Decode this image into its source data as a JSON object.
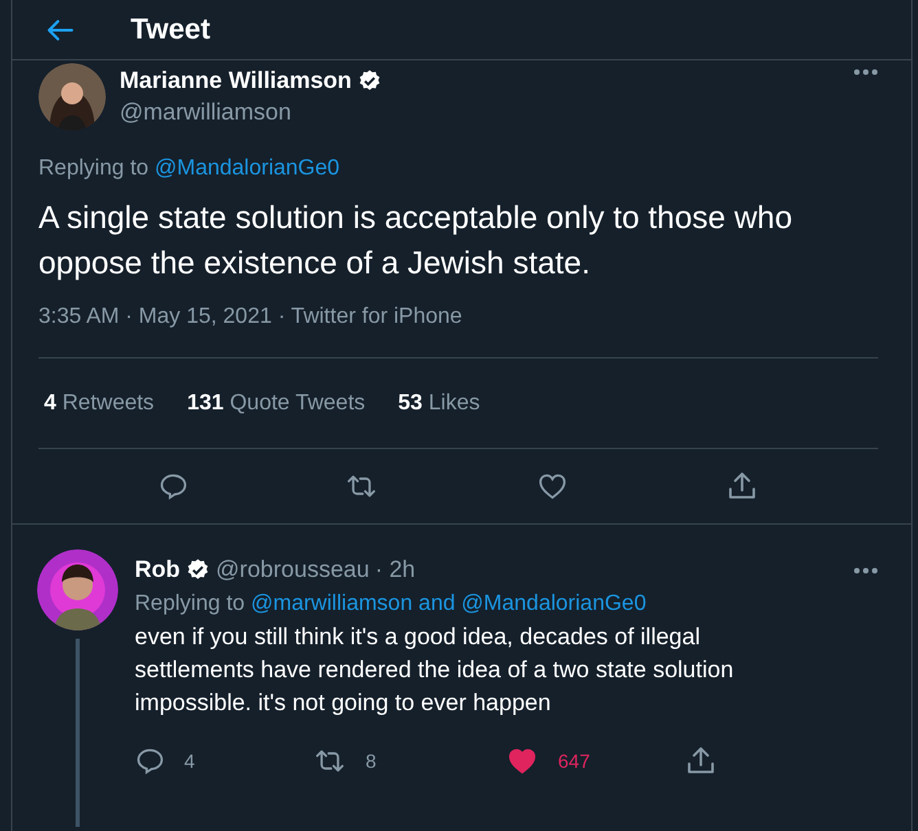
{
  "header": {
    "title": "Tweet"
  },
  "tweet": {
    "author": {
      "name": "Marianne Williamson",
      "handle": "@marwilliamson",
      "verified": true
    },
    "replying_label": "Replying to",
    "replying_to": "@MandalorianGe0",
    "text": "A single state solution is acceptable only to those who oppose the existence of a Jewish state.",
    "meta": "3:35 AM · May 15, 2021 · Twitter for iPhone",
    "stats": [
      {
        "count": "4",
        "label": "Retweets"
      },
      {
        "count": "131",
        "label": "Quote Tweets"
      },
      {
        "count": "53",
        "label": "Likes"
      }
    ],
    "actions": [
      {
        "kind": "reply"
      },
      {
        "kind": "retweet"
      },
      {
        "kind": "like",
        "liked": false
      },
      {
        "kind": "share"
      }
    ]
  },
  "reply": {
    "author": {
      "name": "Rob",
      "handle": "@robrousseau",
      "verified": true,
      "time": "· 2h"
    },
    "replying_label": "Replying to",
    "replying_to": "@marwilliamson and @MandalorianGe0",
    "text": "even if you still think it's a good idea, decades of illegal settlements have rendered the idea of a two state solution impossible. it's not going to ever happen",
    "actions": [
      {
        "kind": "reply",
        "count": "4"
      },
      {
        "kind": "retweet",
        "count": "8"
      },
      {
        "kind": "like",
        "count": "647",
        "liked": true
      },
      {
        "kind": "share"
      }
    ]
  }
}
